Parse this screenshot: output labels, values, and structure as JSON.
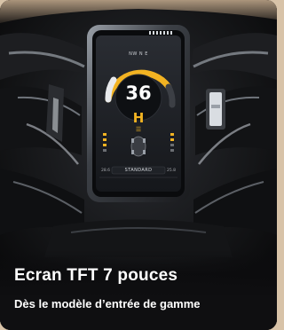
{
  "caption": {
    "title": "Ecran TFT 7 pouces",
    "subtitle": "Dès le modèle d’entrée de gamme"
  },
  "display": {
    "speed": "36",
    "gear": "H",
    "mode_label": "STANDARD",
    "compass": "NW  N  E",
    "range_left": "28.6",
    "range_right": "25.8"
  },
  "colors": {
    "page_background": "#d8c3a8",
    "card_background": "#0b0b0d",
    "accent_yellow": "#f2b322",
    "caption_text": "#ffffff"
  },
  "icons": {
    "headlight": "headlight-icon",
    "scooter": "scooter-top-view-icon"
  }
}
